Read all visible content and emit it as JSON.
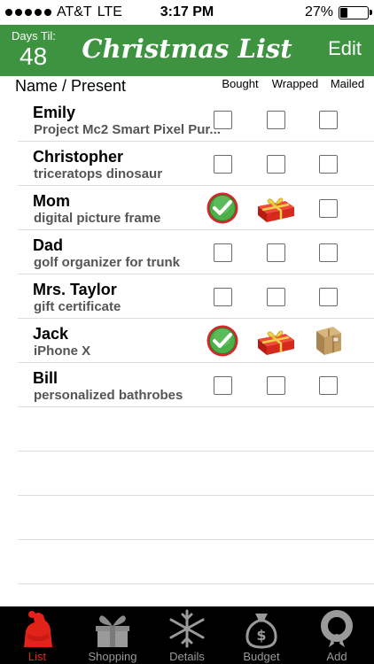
{
  "status": {
    "carrier": "AT&T",
    "network": "LTE",
    "time": "3:17 PM",
    "battery": "27%",
    "battery_level": 0.27
  },
  "header": {
    "days_label": "Days Til:",
    "days_count": "48",
    "title": "Christmas List",
    "edit_label": "Edit"
  },
  "columns": {
    "name": "Name / Present",
    "bought": "Bought",
    "wrapped": "Wrapped",
    "mailed": "Mailed"
  },
  "rows": [
    {
      "name": "Emily",
      "present": "Project Mc2 Smart Pixel Pur...",
      "bought": false,
      "wrapped": false,
      "mailed": false
    },
    {
      "name": "Christopher",
      "present": "triceratops dinosaur",
      "bought": false,
      "wrapped": false,
      "mailed": false
    },
    {
      "name": "Mom",
      "present": "digital picture frame",
      "bought": true,
      "wrapped": true,
      "mailed": false
    },
    {
      "name": "Dad",
      "present": "golf organizer for trunk",
      "bought": false,
      "wrapped": false,
      "mailed": false
    },
    {
      "name": "Mrs. Taylor",
      "present": "gift certificate",
      "bought": false,
      "wrapped": false,
      "mailed": false
    },
    {
      "name": "Jack",
      "present": "iPhone X",
      "bought": true,
      "wrapped": true,
      "mailed": true
    },
    {
      "name": "Bill",
      "present": "personalized bathrobes",
      "bought": false,
      "wrapped": false,
      "mailed": false
    }
  ],
  "tabs": [
    {
      "label": "List",
      "icon": "santa-icon",
      "active": true
    },
    {
      "label": "Shopping",
      "icon": "gift-box-icon",
      "active": false
    },
    {
      "label": "Details",
      "icon": "snowflake-icon",
      "active": false
    },
    {
      "label": "Budget",
      "icon": "money-bag-icon",
      "active": false
    },
    {
      "label": "Add",
      "icon": "wreath-icon",
      "active": false
    }
  ],
  "colors": {
    "header_green": "#3e9340",
    "accent_red": "#e2231a",
    "tab_inactive": "#9a9a9a"
  }
}
